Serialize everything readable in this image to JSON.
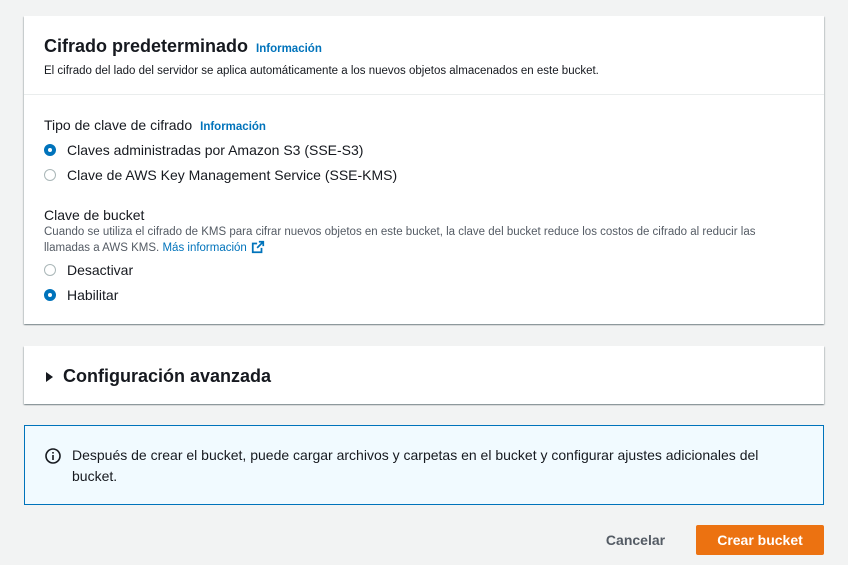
{
  "encryption": {
    "title": "Cifrado predeterminado",
    "info_link": "Información",
    "description": "El cifrado del lado del servidor se aplica automáticamente a los nuevos objetos almacenados en este bucket.",
    "key_type": {
      "label": "Tipo de clave de cifrado",
      "info_link": "Información",
      "options": [
        {
          "label": "Claves administradas por Amazon S3 (SSE-S3)",
          "selected": true
        },
        {
          "label": "Clave de AWS Key Management Service (SSE-KMS)",
          "selected": false
        }
      ]
    },
    "bucket_key": {
      "label": "Clave de bucket",
      "description": "Cuando se utiliza el cifrado de KMS para cifrar nuevos objetos en este bucket, la clave del bucket reduce los costos de cifrado al reducir las llamadas a AWS KMS.",
      "learn_more": "Más información",
      "options": [
        {
          "label": "Desactivar",
          "selected": false
        },
        {
          "label": "Habilitar",
          "selected": true
        }
      ]
    }
  },
  "advanced": {
    "title": "Configuración avanzada"
  },
  "alert": {
    "icon": "info-icon",
    "text": "Después de crear el bucket, puede cargar archivos y carpetas en el bucket y configurar ajustes adicionales del bucket."
  },
  "actions": {
    "cancel_label": "Cancelar",
    "create_label": "Crear bucket"
  },
  "colors": {
    "accent": "#0073bb",
    "primary_button": "#ec7211",
    "alert_background": "#f1faff"
  }
}
